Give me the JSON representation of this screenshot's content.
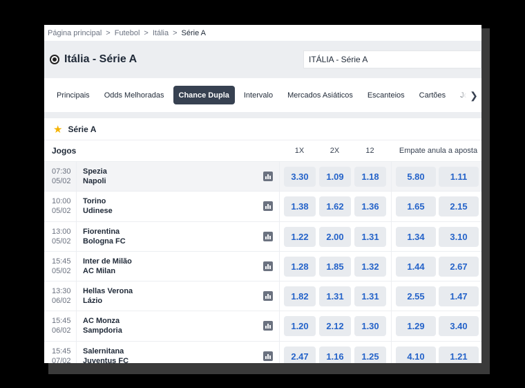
{
  "breadcrumb": [
    "Página principal",
    "Futebol",
    "Itália",
    "Série A"
  ],
  "header": {
    "title": "Itália - Série A",
    "search_value": "ITÁLIA - Série A"
  },
  "tabs": [
    "Principais",
    "Odds Melhoradas",
    "Chance Dupla",
    "Intervalo",
    "Mercados Asiáticos",
    "Escanteios",
    "Cartões",
    "Jogo"
  ],
  "active_tab": "Chance Dupla",
  "league": {
    "name": "Série A"
  },
  "columns": {
    "games": "Jogos",
    "c1": "1X",
    "c2": "2X",
    "c3": "12",
    "dnb": "Empate anula a aposta"
  },
  "matches": [
    {
      "time": "07:30",
      "date": "05/02",
      "home": "Spezia",
      "away": "Napoli",
      "o1x": "3.30",
      "o2x": "1.09",
      "o12": "1.18",
      "d1": "5.80",
      "d2": "1.11"
    },
    {
      "time": "10:00",
      "date": "05/02",
      "home": "Torino",
      "away": "Udinese",
      "o1x": "1.38",
      "o2x": "1.62",
      "o12": "1.36",
      "d1": "1.65",
      "d2": "2.15"
    },
    {
      "time": "13:00",
      "date": "05/02",
      "home": "Fiorentina",
      "away": "Bologna FC",
      "o1x": "1.22",
      "o2x": "2.00",
      "o12": "1.31",
      "d1": "1.34",
      "d2": "3.10"
    },
    {
      "time": "15:45",
      "date": "05/02",
      "home": "Inter de Milão",
      "away": "AC Milan",
      "o1x": "1.28",
      "o2x": "1.85",
      "o12": "1.32",
      "d1": "1.44",
      "d2": "2.67"
    },
    {
      "time": "13:30",
      "date": "06/02",
      "home": "Hellas Verona",
      "away": "Lázio",
      "o1x": "1.82",
      "o2x": "1.31",
      "o12": "1.31",
      "d1": "2.55",
      "d2": "1.47"
    },
    {
      "time": "15:45",
      "date": "06/02",
      "home": "AC Monza",
      "away": "Sampdoria",
      "o1x": "1.20",
      "o2x": "2.12",
      "o12": "1.30",
      "d1": "1.29",
      "d2": "3.40"
    },
    {
      "time": "15:45",
      "date": "07/02",
      "home": "Salernitana",
      "away": "Juventus FC",
      "o1x": "2.47",
      "o2x": "1.16",
      "o12": "1.25",
      "d1": "4.10",
      "d2": "1.21"
    }
  ],
  "icons": {
    "league": "star-icon",
    "sport": "soccer-ball-icon",
    "stats": "bar-chart-icon",
    "scroll": "chevron-right-icon"
  },
  "colors": {
    "odd_text": "#2563c9",
    "active_tab_bg": "#374151",
    "star": "#f5b301"
  }
}
